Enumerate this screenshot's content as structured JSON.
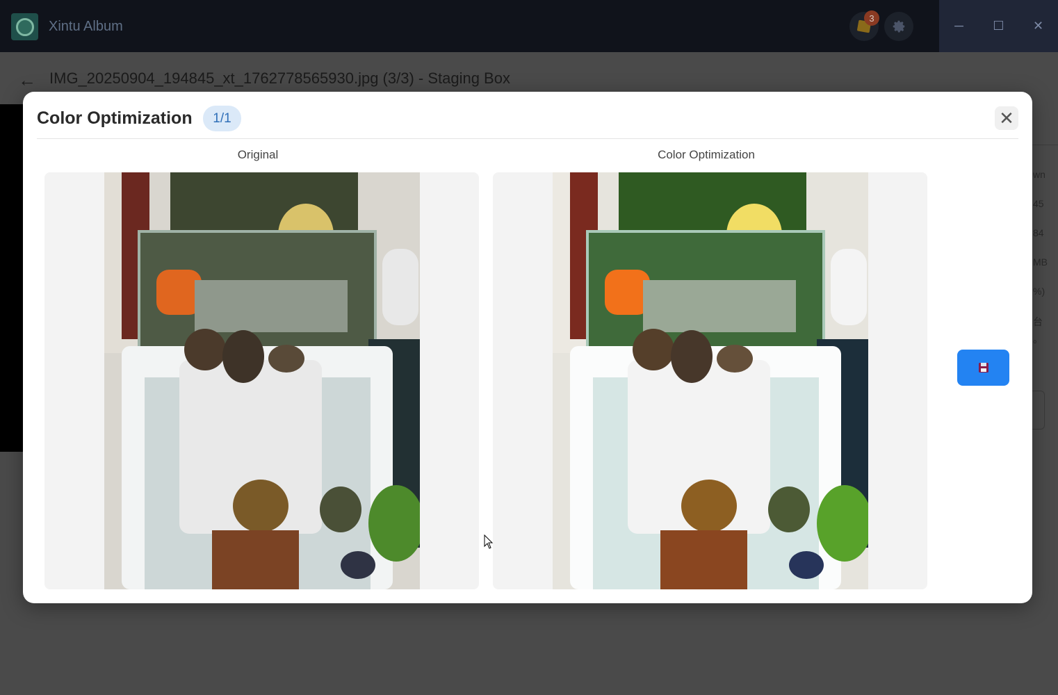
{
  "app": {
    "title": "Xintu Album",
    "notification_count": "3"
  },
  "window_controls": {
    "minimize": "─",
    "maximize": "☐",
    "close": "✕"
  },
  "page": {
    "back": "←",
    "title": "IMG_20250904_194845_xt_1762778565930.jpg (3/3) - Staging Box"
  },
  "right_panel": {
    "snippets": [
      "wn",
      "45",
      "84",
      "MB",
      "%)",
      "台",
      "。"
    ]
  },
  "modal": {
    "title": "Color Optimization",
    "counter": "1/1",
    "close": "✕",
    "original_label": "Original",
    "optimized_label": "Color Optimization"
  },
  "colors": {
    "accent": "#2383f2",
    "badge_bg": "#dbe9f8",
    "badge_fg": "#2f6fb8"
  }
}
